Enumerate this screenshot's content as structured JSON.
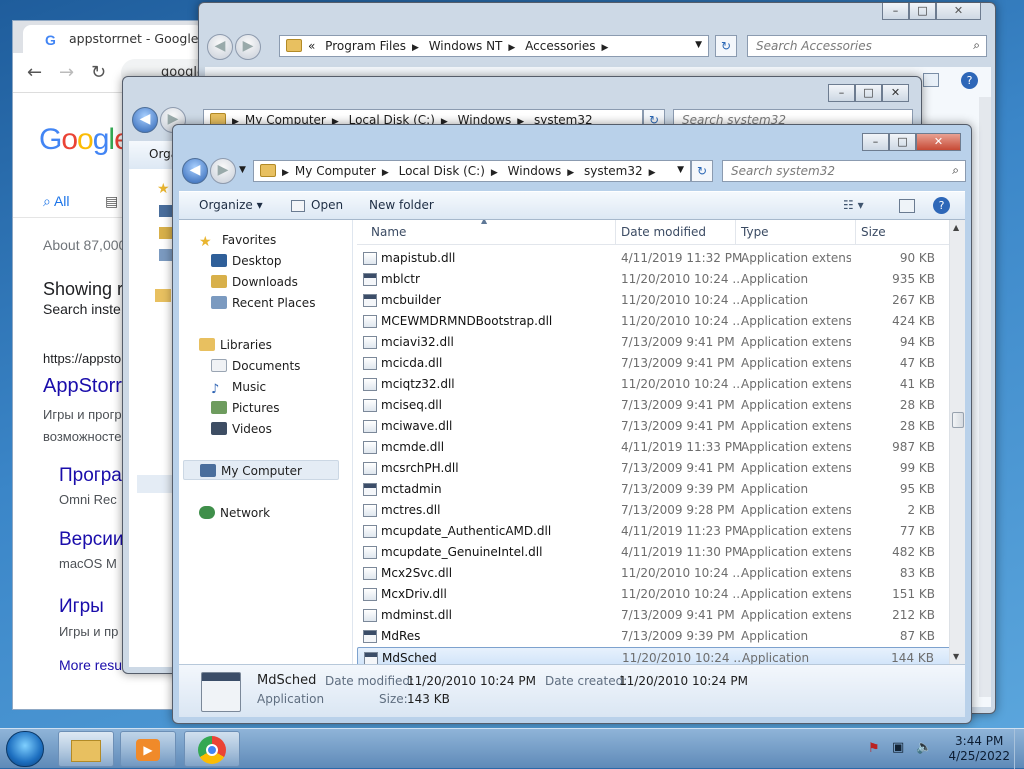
{
  "chrome": {
    "tab_title": "appstorrnet - Google Search",
    "omnibox": "google",
    "logo": "Google",
    "tab_all": "All",
    "results_count": "About 87,000",
    "showing_heading": "Showing r",
    "search_instead": "Search inste",
    "result_url": "https://appsto",
    "result_title": "AppStorr",
    "result_snippet_1": "Игры и прогр",
    "result_snippet_2": "возможносте",
    "sub1_title": "Програ",
    "sub1_desc": "Omni Rec",
    "sub2_title": "Версии",
    "sub2_desc": "macOS M",
    "sub3_title": "Игры",
    "sub3_desc": "Игры и пр",
    "more_results": "More resu"
  },
  "back_explorer": {
    "address": [
      "«",
      "Program Files",
      "Windows NT",
      "Accessories"
    ],
    "search_placeholder": "Search Accessories",
    "ctl_min": "–",
    "ctl_max": "□",
    "ctl_close": "✕"
  },
  "mid_explorer": {
    "address": [
      "My Computer",
      "Local Disk (C:)",
      "Windows",
      "system32"
    ],
    "search_placeholder": "Search system32",
    "organize_partial": "Orga",
    "ctl_min": "–",
    "ctl_max": "□",
    "ctl_close": "✕"
  },
  "main_explorer": {
    "address": [
      "My Computer",
      "Local Disk (C:)",
      "Windows",
      "system32"
    ],
    "search_placeholder": "Search system32",
    "ctl_min": "–",
    "ctl_max": "□",
    "ctl_close": "✕",
    "commands": {
      "organize": "Organize ▾",
      "open": "Open",
      "new_folder": "New folder"
    },
    "nav": {
      "favorites": "Favorites",
      "desktop": "Desktop",
      "downloads": "Downloads",
      "recent": "Recent Places",
      "libraries": "Libraries",
      "documents": "Documents",
      "music": "Music",
      "pictures": "Pictures",
      "videos": "Videos",
      "computer": "My Computer",
      "network": "Network"
    },
    "columns": {
      "name": "Name",
      "date": "Date modified",
      "type": "Type",
      "size": "Size"
    },
    "files": [
      {
        "name": "mapistub.dll",
        "date": "4/11/2019 11:32 PM",
        "type": "Application extens...",
        "size": "90 KB",
        "app": false
      },
      {
        "name": "mblctr",
        "date": "11/20/2010 10:24 ...",
        "type": "Application",
        "size": "935 KB",
        "app": true
      },
      {
        "name": "mcbuilder",
        "date": "11/20/2010 10:24 ...",
        "type": "Application",
        "size": "267 KB",
        "app": true
      },
      {
        "name": "MCEWMDRMNDBootstrap.dll",
        "date": "11/20/2010 10:24 ...",
        "type": "Application extens...",
        "size": "424 KB",
        "app": false
      },
      {
        "name": "mciavi32.dll",
        "date": "7/13/2009 9:41 PM",
        "type": "Application extens...",
        "size": "94 KB",
        "app": false
      },
      {
        "name": "mcicda.dll",
        "date": "7/13/2009 9:41 PM",
        "type": "Application extens...",
        "size": "47 KB",
        "app": false
      },
      {
        "name": "mciqtz32.dll",
        "date": "11/20/2010 10:24 ...",
        "type": "Application extens...",
        "size": "41 KB",
        "app": false
      },
      {
        "name": "mciseq.dll",
        "date": "7/13/2009 9:41 PM",
        "type": "Application extens...",
        "size": "28 KB",
        "app": false
      },
      {
        "name": "mciwave.dll",
        "date": "7/13/2009 9:41 PM",
        "type": "Application extens...",
        "size": "28 KB",
        "app": false
      },
      {
        "name": "mcmde.dll",
        "date": "4/11/2019 11:33 PM",
        "type": "Application extens...",
        "size": "987 KB",
        "app": false
      },
      {
        "name": "mcsrchPH.dll",
        "date": "7/13/2009 9:41 PM",
        "type": "Application extens...",
        "size": "99 KB",
        "app": false
      },
      {
        "name": "mctadmin",
        "date": "7/13/2009 9:39 PM",
        "type": "Application",
        "size": "95 KB",
        "app": true
      },
      {
        "name": "mctres.dll",
        "date": "7/13/2009 9:28 PM",
        "type": "Application extens...",
        "size": "2 KB",
        "app": false
      },
      {
        "name": "mcupdate_AuthenticAMD.dll",
        "date": "4/11/2019 11:23 PM",
        "type": "Application extens...",
        "size": "77 KB",
        "app": false
      },
      {
        "name": "mcupdate_GenuineIntel.dll",
        "date": "4/11/2019 11:30 PM",
        "type": "Application extens...",
        "size": "482 KB",
        "app": false
      },
      {
        "name": "Mcx2Svc.dll",
        "date": "11/20/2010 10:24 ...",
        "type": "Application extens...",
        "size": "83 KB",
        "app": false
      },
      {
        "name": "McxDriv.dll",
        "date": "11/20/2010 10:24 ...",
        "type": "Application extens...",
        "size": "151 KB",
        "app": false
      },
      {
        "name": "mdminst.dll",
        "date": "7/13/2009 9:41 PM",
        "type": "Application extens...",
        "size": "212 KB",
        "app": false
      },
      {
        "name": "MdRes",
        "date": "7/13/2009 9:39 PM",
        "type": "Application",
        "size": "87 KB",
        "app": true
      },
      {
        "name": "MdSched",
        "date": "11/20/2010 10:24 ...",
        "type": "Application",
        "size": "144 KB",
        "app": true,
        "selected": true
      }
    ],
    "details": {
      "name": "MdSched",
      "type": "Application",
      "date_modified_label": "Date modified:",
      "date_modified": "11/20/2010 10:24 PM",
      "date_created_label": "Date created:",
      "date_created": "11/20/2010 10:24 PM",
      "size_label": "Size:",
      "size": "143 KB"
    }
  },
  "taskbar": {
    "time": "3:44 PM",
    "date": "4/25/2022"
  }
}
